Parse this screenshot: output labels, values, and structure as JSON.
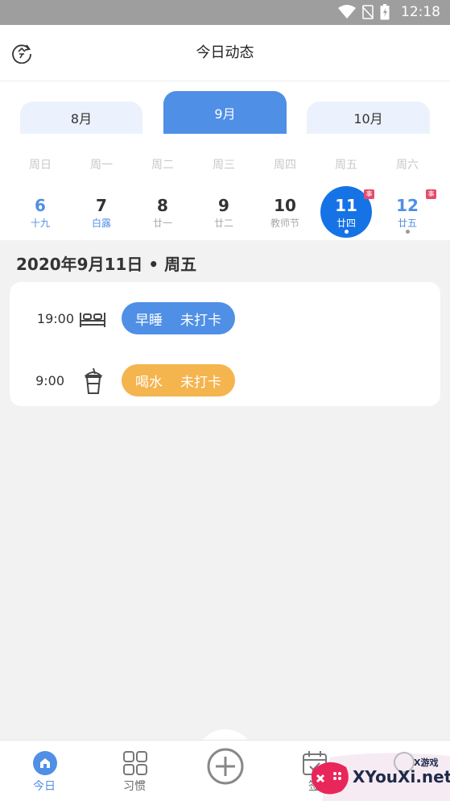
{
  "status_bar": {
    "time": "12:18"
  },
  "header": {
    "title": "今日动态",
    "icon": "today-refresh-icon"
  },
  "calendar": {
    "months": {
      "prev": "8月",
      "current": "9月",
      "next": "10月"
    },
    "weekdays": [
      "周日",
      "周一",
      "周二",
      "周三",
      "周四",
      "周五",
      "周六"
    ],
    "days": [
      {
        "num": "6",
        "sub": "十九"
      },
      {
        "num": "7",
        "sub": "白露"
      },
      {
        "num": "8",
        "sub": "廿一"
      },
      {
        "num": "9",
        "sub": "廿二"
      },
      {
        "num": "10",
        "sub": "教师节"
      },
      {
        "num": "11",
        "sub": "廿四"
      },
      {
        "num": "12",
        "sub": "廿五"
      }
    ],
    "badge_text": "事"
  },
  "date_heading": "2020年9月11日 • 周五",
  "tasks": [
    {
      "time": "19:00",
      "icon": "bed-icon",
      "name": "早睡",
      "status": "未打卡",
      "color": "#4f8fe6"
    },
    {
      "time": "9:00",
      "icon": "drink-cup-icon",
      "name": "喝水",
      "status": "未打卡",
      "color": "#f4b44e"
    }
  ],
  "bottom_nav": {
    "today": "今日",
    "habits": "习惯",
    "checkin": "签",
    "add_icon": "plus-circle-icon"
  },
  "watermark": {
    "text": "XYouXi.net",
    "small": "X游戏"
  },
  "colors": {
    "accent": "#4f8fe6",
    "selected": "#1673e6",
    "drink": "#f4b44e",
    "badge": "#e64b6b"
  }
}
